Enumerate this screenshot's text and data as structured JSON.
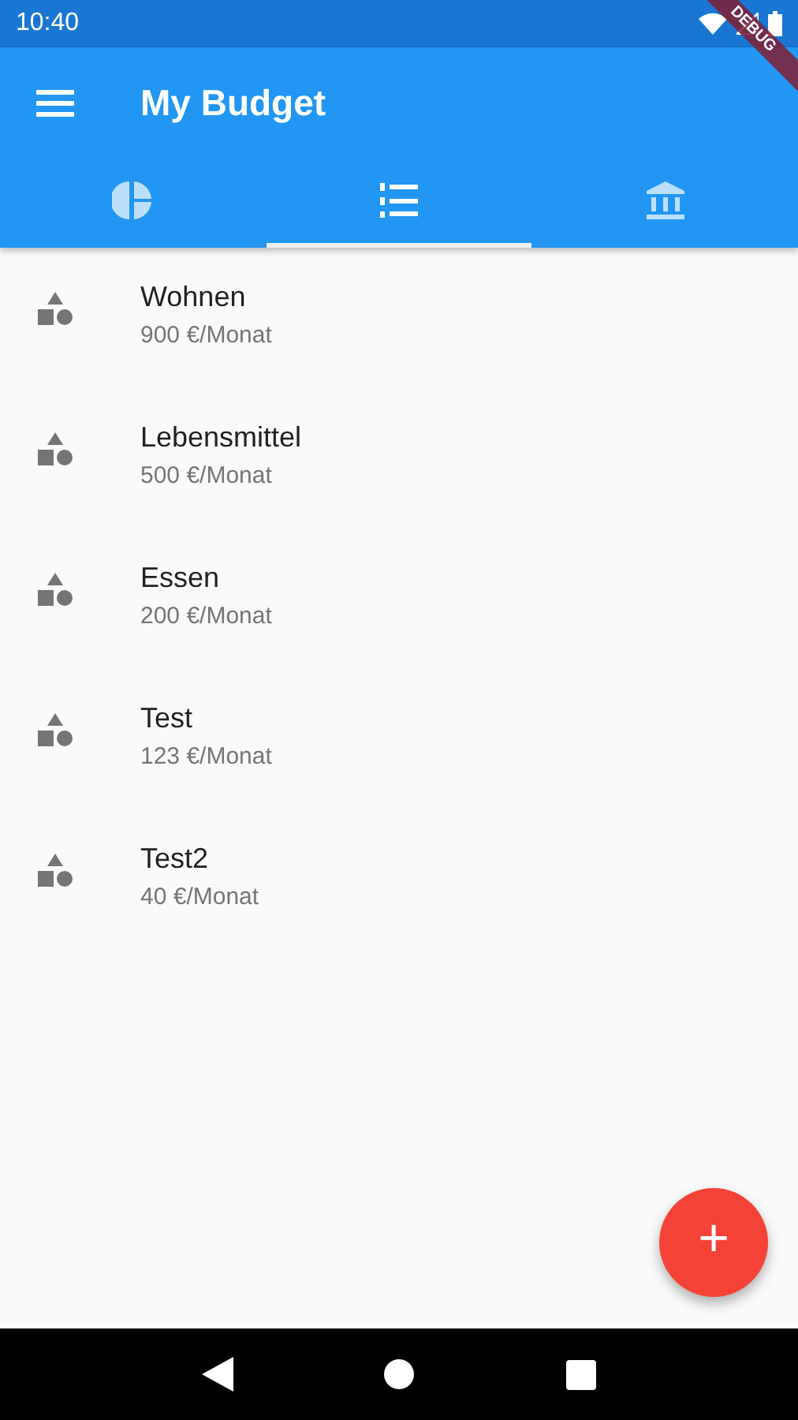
{
  "status_bar": {
    "time": "10:40"
  },
  "debug_banner": "DEBUG",
  "app_bar": {
    "title": "My Budget"
  },
  "tabs": [
    {
      "kind": "pie",
      "selected": false
    },
    {
      "kind": "list",
      "selected": true
    },
    {
      "kind": "bank",
      "selected": false
    }
  ],
  "budgets": [
    {
      "name": "Wohnen",
      "amount": "900 €/Monat"
    },
    {
      "name": "Lebensmittel",
      "amount": "500 €/Monat"
    },
    {
      "name": "Essen",
      "amount": "200 €/Monat"
    },
    {
      "name": "Test",
      "amount": "123 €/Monat"
    },
    {
      "name": "Test2",
      "amount": "40 €/Monat"
    }
  ],
  "fab": {
    "label": "+"
  }
}
